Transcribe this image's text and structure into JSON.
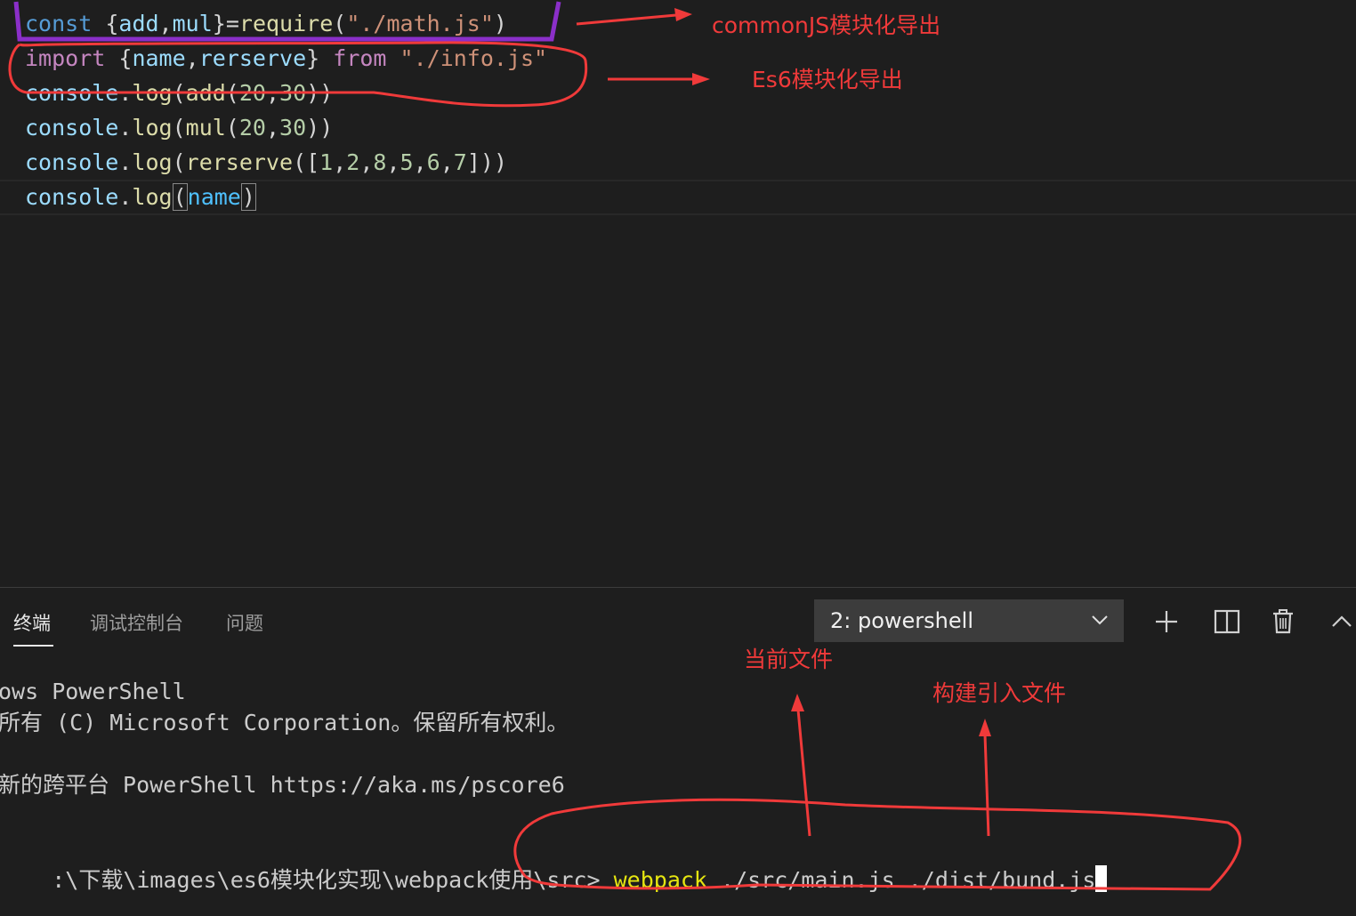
{
  "editor": {
    "lines": [
      {
        "tokens": [
          {
            "t": "const",
            "c": "#569cd6"
          },
          {
            "t": " ",
            "c": "#d4d4d4"
          },
          {
            "t": "{",
            "c": "#d4d4d4"
          },
          {
            "t": "add",
            "c": "#9cdcfe"
          },
          {
            "t": ",",
            "c": "#d4d4d4"
          },
          {
            "t": "mul",
            "c": "#9cdcfe"
          },
          {
            "t": "}",
            "c": "#d4d4d4"
          },
          {
            "t": "=",
            "c": "#d4d4d4"
          },
          {
            "t": "require",
            "c": "#dcdcaa"
          },
          {
            "t": "(",
            "c": "#d4d4d4"
          },
          {
            "t": "\"./math.js\"",
            "c": "#ce9178"
          },
          {
            "t": ")",
            "c": "#d4d4d4"
          }
        ]
      },
      {
        "tokens": [
          {
            "t": "import",
            "c": "#c586c0"
          },
          {
            "t": " ",
            "c": "#d4d4d4"
          },
          {
            "t": "{",
            "c": "#d4d4d4"
          },
          {
            "t": "name",
            "c": "#9cdcfe"
          },
          {
            "t": ",",
            "c": "#d4d4d4"
          },
          {
            "t": "rerserve",
            "c": "#9cdcfe"
          },
          {
            "t": "}",
            "c": "#d4d4d4"
          },
          {
            "t": " ",
            "c": "#d4d4d4"
          },
          {
            "t": "from",
            "c": "#c586c0"
          },
          {
            "t": " ",
            "c": "#d4d4d4"
          },
          {
            "t": "\"./info.js\"",
            "c": "#ce9178"
          }
        ]
      },
      {
        "tokens": [
          {
            "t": "console",
            "c": "#9cdcfe"
          },
          {
            "t": ".",
            "c": "#d4d4d4"
          },
          {
            "t": "log",
            "c": "#dcdcaa"
          },
          {
            "t": "(",
            "c": "#d4d4d4"
          },
          {
            "t": "add",
            "c": "#dcdcaa"
          },
          {
            "t": "(",
            "c": "#d4d4d4"
          },
          {
            "t": "20",
            "c": "#b5cea8"
          },
          {
            "t": ",",
            "c": "#d4d4d4"
          },
          {
            "t": "30",
            "c": "#b5cea8"
          },
          {
            "t": "))",
            "c": "#d4d4d4"
          }
        ]
      },
      {
        "tokens": [
          {
            "t": "console",
            "c": "#9cdcfe"
          },
          {
            "t": ".",
            "c": "#d4d4d4"
          },
          {
            "t": "log",
            "c": "#dcdcaa"
          },
          {
            "t": "(",
            "c": "#d4d4d4"
          },
          {
            "t": "mul",
            "c": "#dcdcaa"
          },
          {
            "t": "(",
            "c": "#d4d4d4"
          },
          {
            "t": "20",
            "c": "#b5cea8"
          },
          {
            "t": ",",
            "c": "#d4d4d4"
          },
          {
            "t": "30",
            "c": "#b5cea8"
          },
          {
            "t": "))",
            "c": "#d4d4d4"
          }
        ]
      },
      {
        "tokens": [
          {
            "t": "console",
            "c": "#9cdcfe"
          },
          {
            "t": ".",
            "c": "#d4d4d4"
          },
          {
            "t": "log",
            "c": "#dcdcaa"
          },
          {
            "t": "(",
            "c": "#d4d4d4"
          },
          {
            "t": "rerserve",
            "c": "#dcdcaa"
          },
          {
            "t": "([",
            "c": "#d4d4d4"
          },
          {
            "t": "1",
            "c": "#b5cea8"
          },
          {
            "t": ",",
            "c": "#d4d4d4"
          },
          {
            "t": "2",
            "c": "#b5cea8"
          },
          {
            "t": ",",
            "c": "#d4d4d4"
          },
          {
            "t": "8",
            "c": "#b5cea8"
          },
          {
            "t": ",",
            "c": "#d4d4d4"
          },
          {
            "t": "5",
            "c": "#b5cea8"
          },
          {
            "t": ",",
            "c": "#d4d4d4"
          },
          {
            "t": "6",
            "c": "#b5cea8"
          },
          {
            "t": ",",
            "c": "#d4d4d4"
          },
          {
            "t": "7",
            "c": "#b5cea8"
          },
          {
            "t": "]))",
            "c": "#d4d4d4"
          }
        ]
      },
      {
        "tokens": [
          {
            "t": "console",
            "c": "#9cdcfe"
          },
          {
            "t": ".",
            "c": "#d4d4d4"
          },
          {
            "t": "log",
            "c": "#dcdcaa"
          },
          {
            "t": "(",
            "c": "#d4d4d4",
            "box": true
          },
          {
            "t": "name",
            "c": "#4fc1ff"
          },
          {
            "t": ")",
            "c": "#d4d4d4",
            "box": true
          }
        ]
      }
    ]
  },
  "panel": {
    "tabs": [
      {
        "label": "终端",
        "active": true
      },
      {
        "label": "调试控制台",
        "active": false
      },
      {
        "label": "问题",
        "active": false
      }
    ],
    "terminal_select": "2: powershell",
    "icons": [
      "plus-icon",
      "split-icon",
      "trash-icon",
      "chevron-up-icon"
    ]
  },
  "terminal": {
    "line1": "ows PowerShell",
    "line2": "所有 (C) Microsoft Corporation。保留所有权利。",
    "line3": "新的跨平台 PowerShell https://aka.ms/pscore6",
    "prompt": ":\\下载\\images\\es6模块化实现\\webpack使用\\src> ",
    "command": "webpack",
    "args": " ./src/main.js ./dist/bund.js"
  },
  "annotations": {
    "commonjs": "commonJS模块化导出",
    "es6": "Es6模块化导出",
    "current_file": "当前文件",
    "build_file": "构建引入文件",
    "color": "#f03a3a",
    "highlight_purple": "#8b2fc9"
  }
}
